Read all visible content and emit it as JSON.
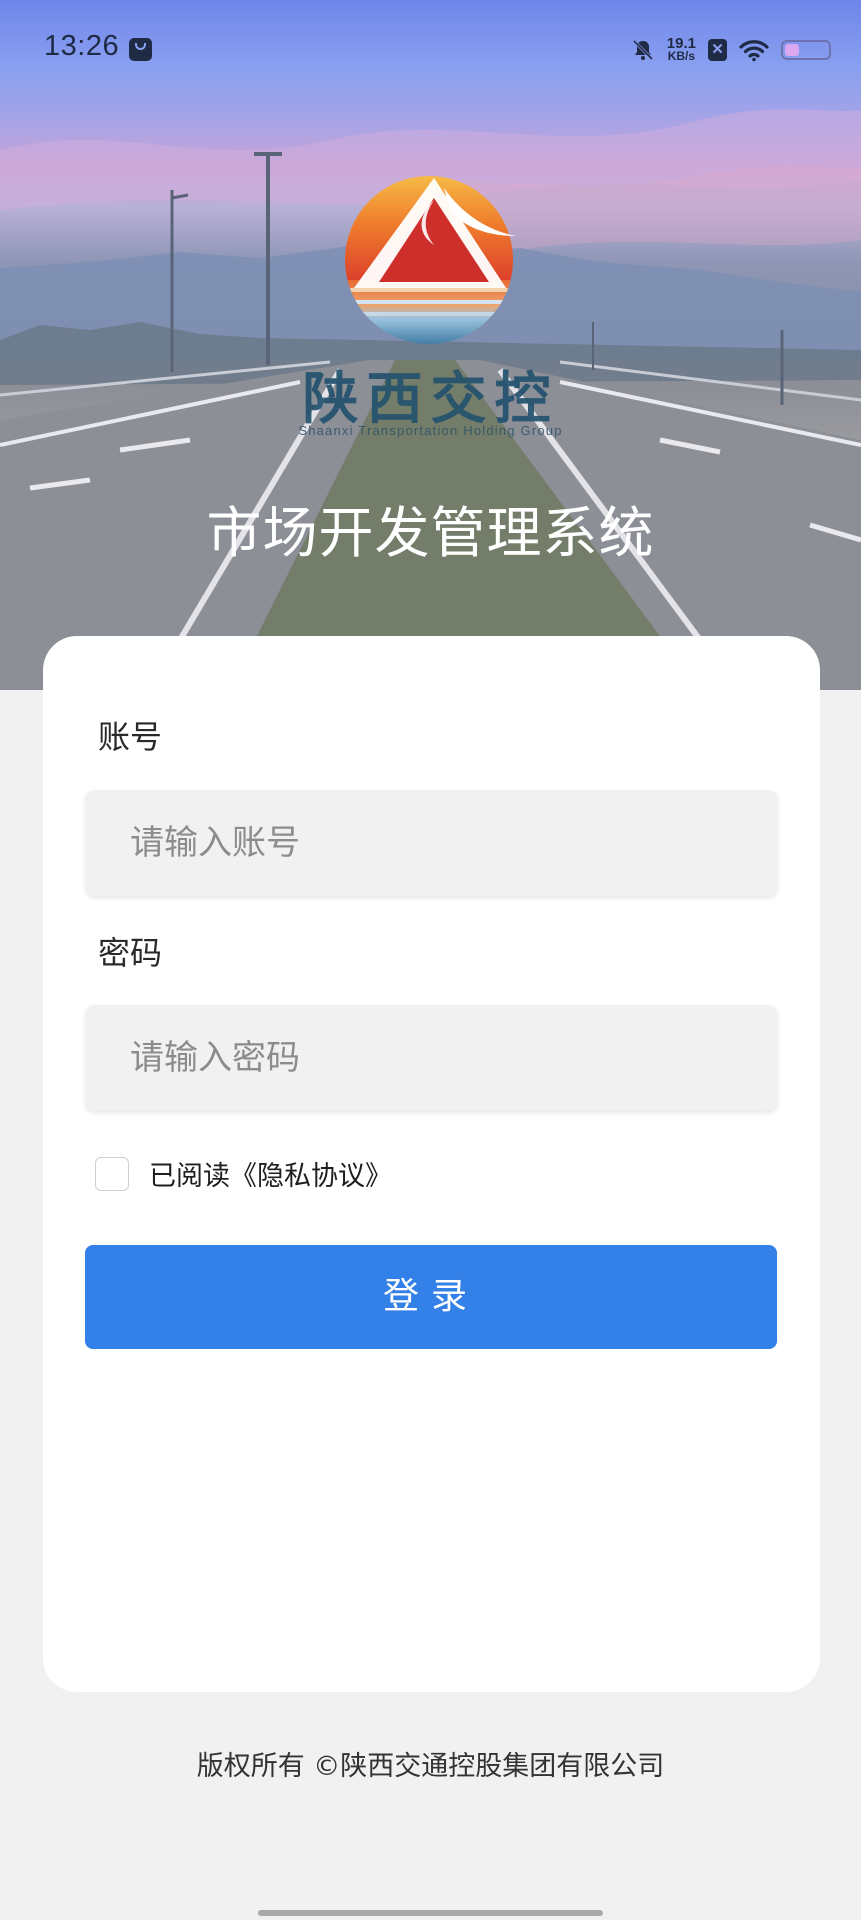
{
  "status_bar": {
    "time": "13:26",
    "net_speed_value": "19.1",
    "net_speed_unit": "KB/s",
    "notification_box_glyph": "✕",
    "battery_level": 0.35,
    "icons": [
      "bag-icon",
      "bell-muted-icon",
      "wifi-icon",
      "battery-icon"
    ]
  },
  "logo": {
    "name_cn": "陕西交控",
    "name_en": "Shaanxi Transportation Holding Group"
  },
  "app_title": "市场开发管理系统",
  "form": {
    "account_label": "账号",
    "account_placeholder": "请输入账号",
    "password_label": "密码",
    "password_placeholder": "请输入密码",
    "agree_text": "已阅读《隐私协议》",
    "agree_checked": false,
    "login_label": "登录"
  },
  "footer": {
    "copyright": "版权所有 ©陕西交通控股集团有限公司"
  },
  "colors": {
    "primary": "#3280e8",
    "card_bg": "#ffffff",
    "page_bg": "#f1f1f1",
    "logo_text": "#23526e"
  }
}
